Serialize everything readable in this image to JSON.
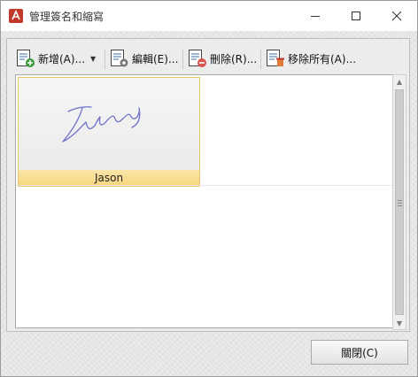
{
  "window": {
    "title": "管理簽名和縮寫",
    "controls": {
      "minimize": "minimize",
      "maximize": "maximize",
      "close": "close"
    }
  },
  "toolbar": {
    "add_label": "新增(A)...",
    "edit_label": "編輯(E)...",
    "delete_label": "刪除(R)...",
    "remove_all_label": "移除所有(A)..."
  },
  "signatures": [
    {
      "name": "Jason",
      "selected": true
    }
  ],
  "footer": {
    "close_label": "關閉(C)"
  },
  "colors": {
    "selection_fill": "#f6d57e",
    "selection_border": "#e8c66a",
    "signature_ink": "#6e72c9",
    "add_badge": "#3a9a3a",
    "delete_badge": "#d9534f",
    "app_icon": "#c0392b"
  },
  "icons": [
    "pdf-app-icon",
    "add-doc-icon",
    "edit-doc-icon",
    "delete-doc-icon",
    "remove-all-doc-icon"
  ]
}
